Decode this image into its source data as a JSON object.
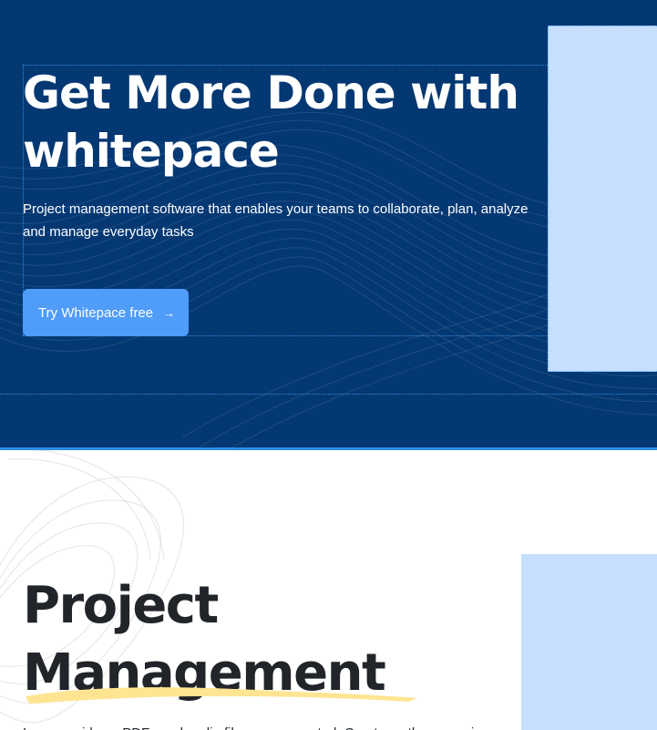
{
  "hero": {
    "title": "Get More Done with whitepace",
    "subtitle": "Project management software that enables your teams to collaborate, plan, analyze and manage everyday tasks",
    "cta_label": "Try Whitepace free",
    "cta_arrow": "→",
    "background_color": "#043873",
    "cta_color": "#4F9CF9",
    "image_placeholder_color": "#C5DFFC"
  },
  "section2": {
    "title": "Project Management",
    "text": "Images, videos, PDFs and audio files are supported. Create math expressions",
    "underline_color": "#FFE492",
    "image_placeholder_color": "#C5DFFC"
  }
}
